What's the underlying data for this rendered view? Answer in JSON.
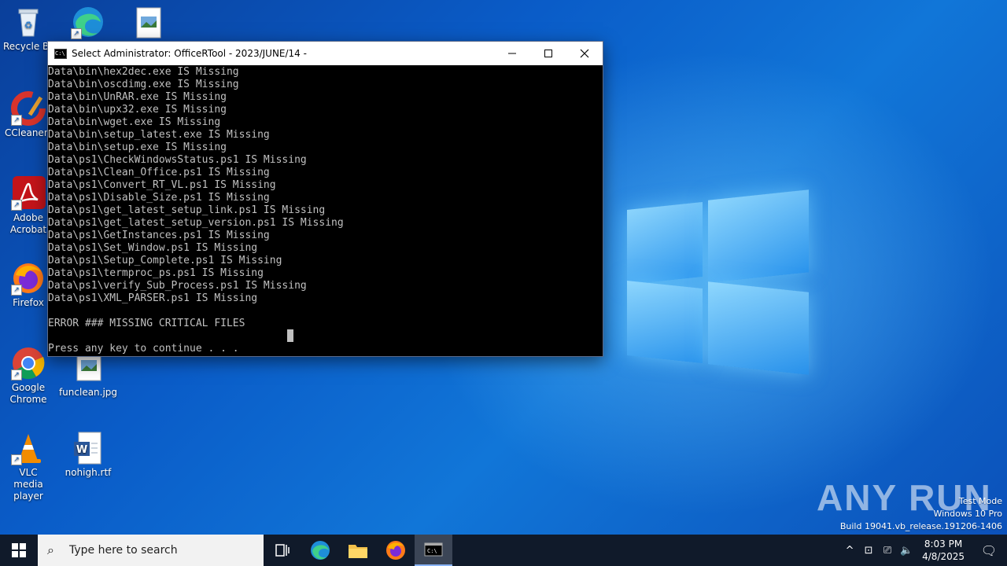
{
  "desktop": {
    "icons": [
      {
        "label": "Recycle Bin"
      },
      {
        "label": ""
      },
      {
        "label": ""
      },
      {
        "label": "CCleaner"
      },
      {
        "label": "Adobe Acrobat"
      },
      {
        "label": "Firefox"
      },
      {
        "label": "Google Chrome"
      },
      {
        "label": "funclean.jpg"
      },
      {
        "label": "VLC media player"
      },
      {
        "label": "nohigh.rtf"
      }
    ]
  },
  "console_window": {
    "title": "Select Administrator:  OfficeRTool - 2023/JUNE/14 -",
    "lines": [
      "Data\\bin\\hex2dec.exe IS Missing",
      "Data\\bin\\oscdimg.exe IS Missing",
      "Data\\bin\\UnRAR.exe IS Missing",
      "Data\\bin\\upx32.exe IS Missing",
      "Data\\bin\\wget.exe IS Missing",
      "Data\\bin\\setup_latest.exe IS Missing",
      "Data\\bin\\setup.exe IS Missing",
      "Data\\ps1\\CheckWindowsStatus.ps1 IS Missing",
      "Data\\ps1\\Clean_Office.ps1 IS Missing",
      "Data\\ps1\\Convert_RT_VL.ps1 IS Missing",
      "Data\\ps1\\Disable_Size.ps1 IS Missing",
      "Data\\ps1\\get_latest_setup_link.ps1 IS Missing",
      "Data\\ps1\\get_latest_setup_version.ps1 IS Missing",
      "Data\\ps1\\GetInstances.ps1 IS Missing",
      "Data\\ps1\\Set_Window.ps1 IS Missing",
      "Data\\ps1\\Setup_Complete.ps1 IS Missing",
      "Data\\ps1\\termproc_ps.ps1 IS Missing",
      "Data\\ps1\\verify_Sub_Process.ps1 IS Missing",
      "Data\\ps1\\XML_PARSER.ps1 IS Missing",
      "",
      "ERROR ### MISSING CRITICAL FILES",
      "",
      "Press any key to continue . . ."
    ]
  },
  "watermark": {
    "brand": "ANY RUN",
    "line1": "Test Mode",
    "line2": "Windows 10 Pro",
    "line3": "Build 19041.vb_release.191206-1406"
  },
  "taskbar": {
    "search_placeholder": "Type here to search",
    "time": "8:03 PM",
    "date": "4/8/2025"
  }
}
